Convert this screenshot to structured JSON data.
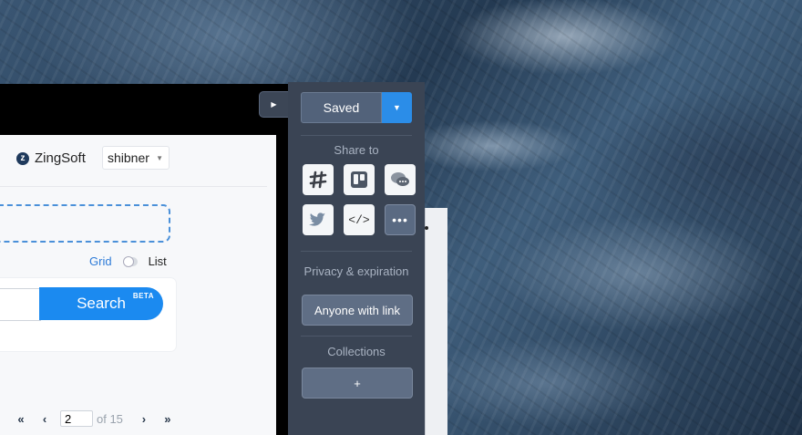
{
  "app": {
    "brand": "ZingSoft",
    "user": "shibner"
  },
  "view_toggle": {
    "grid": "Grid",
    "list": "List"
  },
  "search": {
    "button_label": "Search",
    "badge": "BETA"
  },
  "pager": {
    "page_value": "2",
    "of_label": "of 15"
  },
  "panel": {
    "saved_label": "Saved",
    "share_title": "Share to",
    "share_targets": [
      "slack-icon",
      "trello-icon",
      "chat-icon",
      "twitter-icon",
      "embed-code-icon",
      "more-icon"
    ],
    "code_glyph": "</>",
    "more_glyph": "•••",
    "privacy_title": "Privacy & expiration",
    "privacy_value": "Anyone with link",
    "collections_title": "Collections",
    "add_collection_label": "+"
  },
  "colors": {
    "accent": "#2b8de8",
    "search_button": "#1b8af0",
    "panel_bg": "#3a4454"
  }
}
